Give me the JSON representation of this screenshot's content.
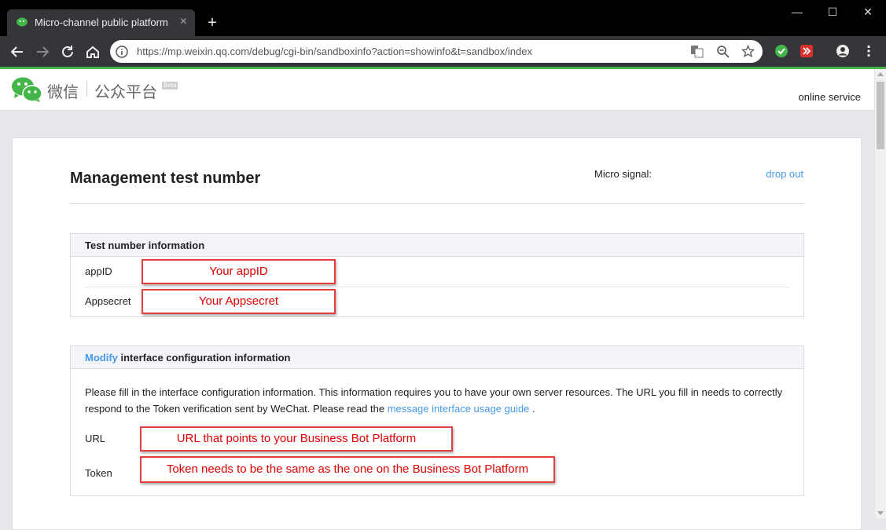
{
  "browser": {
    "tab_title": "Micro-channel public platform",
    "tab_close": "×",
    "new_tab": "+",
    "url": "https://mp.weixin.qq.com/debug/cgi-bin/sandboxinfo?action=showinfo&t=sandbox/index",
    "window_minimize": "—",
    "window_maximize": "☐",
    "window_close": "✕"
  },
  "header": {
    "logo_text": "微信",
    "logo_sub": "公众平台",
    "beta": "Beta",
    "online_service": "online service"
  },
  "page": {
    "title": "Management test number",
    "micro_signal_label": "Micro signal:",
    "drop_out": "drop out"
  },
  "test_info": {
    "heading": "Test number information",
    "appid_label": "appID",
    "appid_value": "Your appID",
    "appsecret_label": "Appsecret",
    "appsecret_value": "Your Appsecret"
  },
  "config": {
    "heading_link": "Modify",
    "heading_rest": " interface configuration information",
    "desc_text": "Please fill in the interface configuration information. This information requires you to have your own server resources. The URL you fill in needs to correctly respond to the Token verification sent by WeChat. Please read the ",
    "desc_link": "message interface usage guide",
    "desc_end": " .",
    "url_label": "URL",
    "url_value": "URL that points to your Business Bot Platform",
    "token_label": "Token",
    "token_value": "Token needs to be the same as the one on the Business Bot Platform"
  },
  "colors": {
    "accent_link": "#459ae9",
    "wechat_green": "#44b549",
    "annotation_red": "#e00000"
  }
}
